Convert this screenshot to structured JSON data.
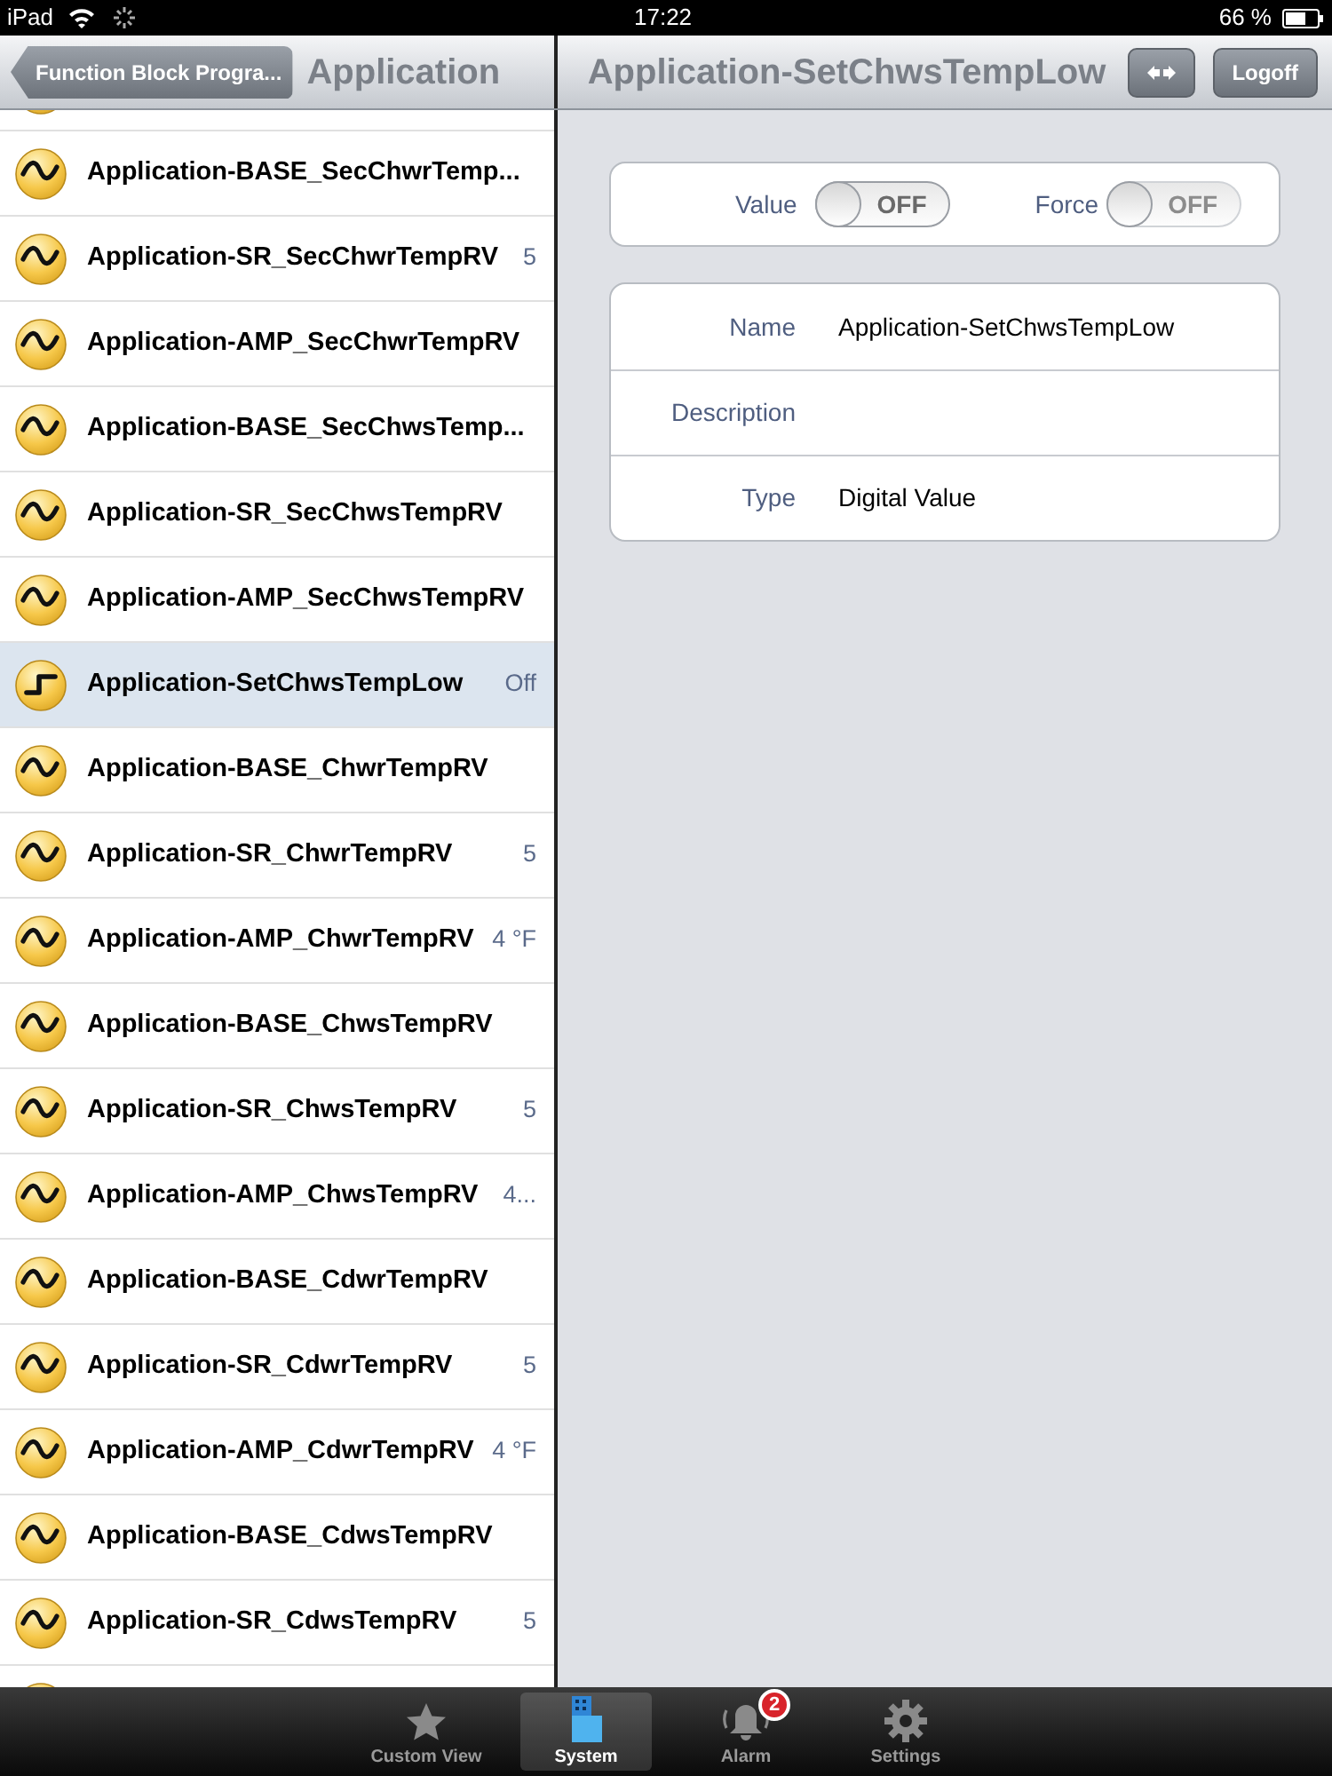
{
  "status_bar": {
    "device": "iPad",
    "time": "17:22",
    "battery": "66 %"
  },
  "left_nav": {
    "back_button": "Function Block Progra...",
    "title": "Application"
  },
  "right_nav": {
    "title": "Application-SetChwsTempLow",
    "buttons": [
      {
        "kind": "swap"
      },
      {
        "kind": "text",
        "label": "Logoff"
      }
    ]
  },
  "list": [
    {
      "kind": "analog",
      "selected": false
    },
    {
      "kind": "analog",
      "label": "Application-BASE_SecChwrTemp...",
      "selected": false
    },
    {
      "kind": "analog",
      "label": "Application-SR_SecChwrTempRV",
      "value": "5",
      "selected": false
    },
    {
      "kind": "analog",
      "label": "Application-AMP_SecChwrTempRV",
      "selected": false
    },
    {
      "kind": "analog",
      "label": "Application-BASE_SecChwsTemp...",
      "selected": false
    },
    {
      "kind": "analog",
      "label": "Application-SR_SecChwsTempRV",
      "selected": false
    },
    {
      "kind": "analog",
      "label": "Application-AMP_SecChwsTempRV",
      "selected": false
    },
    {
      "kind": "digital",
      "label": "Application-SetChwsTempLow",
      "value": "Off",
      "selected": true
    },
    {
      "kind": "analog",
      "label": "Application-BASE_ChwrTempRV",
      "selected": false
    },
    {
      "kind": "analog",
      "label": "Application-SR_ChwrTempRV",
      "value": "5",
      "selected": false
    },
    {
      "kind": "analog",
      "label": "Application-AMP_ChwrTempRV",
      "value": "4 °F",
      "selected": false
    },
    {
      "kind": "analog",
      "label": "Application-BASE_ChwsTempRV",
      "selected": false
    },
    {
      "kind": "analog",
      "label": "Application-SR_ChwsTempRV",
      "value": "5",
      "selected": false
    },
    {
      "kind": "analog",
      "label": "Application-AMP_ChwsTempRV",
      "value": "4...",
      "selected": false
    },
    {
      "kind": "analog",
      "label": "Application-BASE_CdwrTempRV",
      "selected": false
    },
    {
      "kind": "analog",
      "label": "Application-SR_CdwrTempRV",
      "value": "5",
      "selected": false
    },
    {
      "kind": "analog",
      "label": "Application-AMP_CdwrTempRV",
      "value": "4 °F",
      "selected": false
    },
    {
      "kind": "analog",
      "label": "Application-BASE_CdwsTempRV",
      "selected": false
    },
    {
      "kind": "analog",
      "label": "Application-SR_CdwsTempRV",
      "value": "5",
      "selected": false
    },
    {
      "kind": "analog",
      "selected": false
    }
  ],
  "toggles": [
    {
      "label": "Value",
      "state": "OFF",
      "on": false,
      "disabled": false
    },
    {
      "label": "Force",
      "state": "OFF",
      "on": false,
      "disabled": true
    }
  ],
  "properties": [
    {
      "label": "Name",
      "value": "Application-SetChwsTempLow"
    },
    {
      "label": "Description"
    },
    {
      "label": "Type",
      "value": "Digital Value"
    }
  ],
  "tab_bar": [
    {
      "kind": "star",
      "label": "Custom View",
      "selected": false
    },
    {
      "kind": "building",
      "label": "System",
      "selected": true
    },
    {
      "kind": "bell",
      "label": "Alarm",
      "badge": "2",
      "selected": false
    },
    {
      "kind": "gear",
      "label": "Settings",
      "selected": false
    }
  ]
}
